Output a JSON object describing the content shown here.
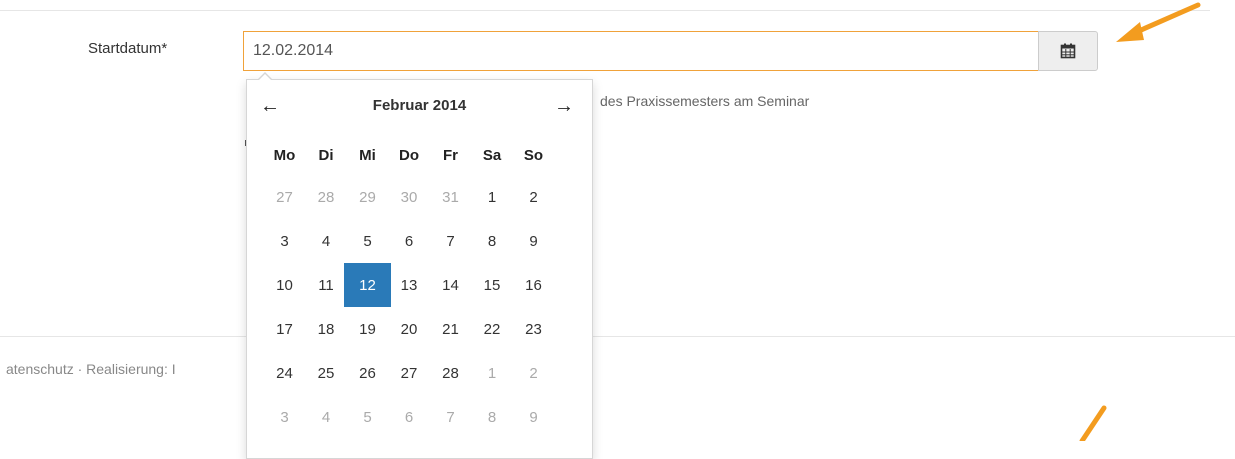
{
  "form": {
    "label": "Startdatum*",
    "value": "12.02.2014",
    "help_text": "des Praxissemesters am Seminar"
  },
  "footer": {
    "text": "atenschutz · Realisierung: I"
  },
  "datepicker": {
    "prev": "←",
    "next": "→",
    "title": "Februar 2014",
    "weekdays": [
      "Mo",
      "Di",
      "Mi",
      "Do",
      "Fr",
      "Sa",
      "So"
    ],
    "weeks": [
      [
        "27",
        "28",
        "29",
        "30",
        "31",
        "1",
        "2"
      ],
      [
        "3",
        "4",
        "5",
        "6",
        "7",
        "8",
        "9"
      ],
      [
        "10",
        "11",
        "12",
        "13",
        "14",
        "15",
        "16"
      ],
      [
        "17",
        "18",
        "19",
        "20",
        "21",
        "22",
        "23"
      ],
      [
        "24",
        "25",
        "26",
        "27",
        "28",
        "1",
        "2"
      ],
      [
        "3",
        "4",
        "5",
        "6",
        "7",
        "8",
        "9"
      ]
    ],
    "selected_day": "12"
  },
  "colors": {
    "accent_border": "#f0a23a",
    "selected_bg": "#2a7ab8",
    "annotation_arrow": "#f39c1f"
  },
  "icons": {
    "calendar_button": "calendar-icon"
  }
}
